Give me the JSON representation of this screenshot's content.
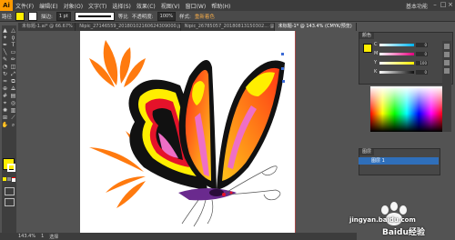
{
  "app": {
    "logo": "Ai",
    "workspace": "基本功能"
  },
  "menus": [
    "文件(F)",
    "编辑(E)",
    "对象(O)",
    "文字(T)",
    "选择(S)",
    "效果(C)",
    "视图(V)",
    "窗口(W)",
    "帮助(H)"
  ],
  "control": {
    "selection_label": "路径",
    "stroke_label": "描边:",
    "stroke_weight": "1 pt",
    "profile_label": "等比",
    "opacity_label": "不透明度:",
    "opacity_value": "100%",
    "style_label": "样式:",
    "recolor_btn": "重新着色"
  },
  "tabs": [
    {
      "label": "未标题-1.ai* @ 66.67% ..."
    },
    {
      "label": "Nipic_27146559_20180102160624309000.jpg* ..."
    },
    {
      "label": "Nipic_26785057_20180813150302... @ 100% ..."
    },
    {
      "label": "未标题-1* @ 143.4% (CMYK/预览)"
    }
  ],
  "status": {
    "zoom": "143.4%",
    "page": "1",
    "mode": "选择"
  },
  "panels": {
    "color_tab": "颜色",
    "sliders": [
      {
        "label": "C",
        "value": "0",
        "color": "#00b4ef"
      },
      {
        "label": "M",
        "value": "0",
        "color": "#e5007f"
      },
      {
        "label": "Y",
        "value": "100",
        "color": "#ffee00"
      },
      {
        "label": "K",
        "value": "0",
        "color": "#111111"
      }
    ],
    "layers_tab": "图层",
    "layer_name": "图层 1"
  },
  "colors": {
    "fill": "#ffee00",
    "stroke": "#ffffff",
    "accent": "#ff9a00",
    "guide": "#e04848"
  },
  "watermark": {
    "brand": "Baidu经验",
    "url": "jingyan.baidu.com"
  }
}
